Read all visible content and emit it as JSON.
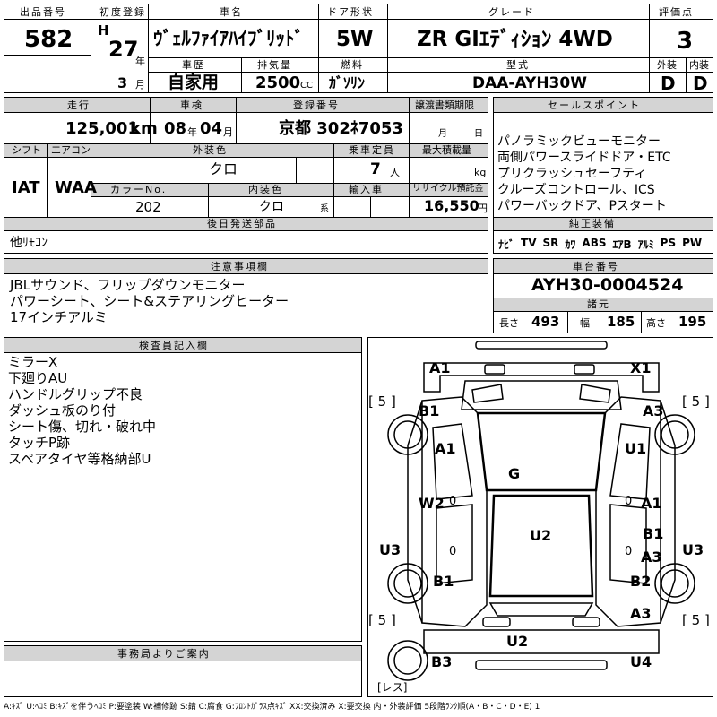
{
  "header": {
    "lot_no_label": "出品番号",
    "lot_no": "582",
    "first_reg_label": "初度登録",
    "era": "H",
    "year": "27",
    "year_unit": "年",
    "month": "3",
    "month_unit": "月",
    "model_label": "車名",
    "model": "ｳﾞｪﾙﾌｧｲｱﾊｲﾌﾞﾘｯﾄﾞ",
    "history_label": "車歴",
    "history": "自家用",
    "displacement_label": "排気量",
    "displacement": "2500",
    "displacement_unit": "CC",
    "door_label": "ドア形状",
    "door": "5W",
    "fuel_label": "燃料",
    "fuel": "ｶﾞｿﾘﾝ",
    "grade_label": "グレード",
    "grade": "ZR GIｴﾃﾞｨｼｮﾝ 4WD",
    "model_code_label": "型式",
    "model_code": "DAA-AYH30W",
    "score_label": "評価点",
    "score": "3",
    "ext_label": "外装",
    "ext": "D",
    "int_label": "内装",
    "int": "D"
  },
  "spec": {
    "mileage_label": "走行",
    "mileage": "125,001",
    "mileage_unit": "km",
    "inspection_label": "車検",
    "insp_year": "08",
    "insp_year_unit": "年",
    "insp_month": "04",
    "insp_month_unit": "月",
    "plate_label": "登録番号",
    "plate": "京都 302ﾈ7053",
    "transfer_label": "譲渡書類期限",
    "transfer_month_unit": "月",
    "transfer_day_unit": "日",
    "shift_label": "シフト",
    "shift": "IAT",
    "ac_label": "エアコン",
    "ac": "WAA",
    "ext_color_label": "外装色",
    "ext_color": "クロ",
    "capacity_label": "乗車定員",
    "capacity": "7",
    "capacity_unit": "人",
    "load_label": "最大積載量",
    "load_unit": "kg",
    "color_no_label": "カラーNo.",
    "color_no": "202",
    "int_color_label": "内装色",
    "int_color": "クロ",
    "int_color_unit": "系",
    "import_label": "輸入車",
    "recycle_label": "リサイクル預託金",
    "recycle": "16,550",
    "recycle_unit": "円"
  },
  "sales": {
    "label": "セールスポイント",
    "items": [
      "パノラミックビューモニター",
      "両側パワースライドドア・ETC",
      "プリクラッシュセーフティ",
      "クルーズコントロール、ICS",
      "パワーバックドア、Pスタート"
    ]
  },
  "later_parts": {
    "label": "後日発送部品",
    "value": "他ﾘﾓｺﾝ"
  },
  "equipment": {
    "label": "純正装備",
    "items": [
      "ﾅﾋﾞ",
      "TV",
      "SR",
      "ｶﾜ",
      "ABS",
      "ｴｱB",
      "ｱﾙﾐ",
      "PS",
      "PW"
    ]
  },
  "notes": {
    "label": "注意事項欄",
    "lines": [
      "JBLサウンド、フリップダウンモニター",
      "パワーシート、シート&ステアリングヒーター",
      "17インチアルミ"
    ]
  },
  "chassis": {
    "label": "車台番号",
    "value": "AYH30-0004524",
    "dims_label": "諸元",
    "length_label": "長さ",
    "length": "493",
    "width_label": "幅",
    "width": "185",
    "height_label": "高さ",
    "height": "195"
  },
  "inspector": {
    "label": "検査員記入欄",
    "lines": [
      "ミラーX",
      "下廻りAU",
      "ハンドルグリップ不良",
      "ダッシュ板のり付",
      "シート傷、切れ・破れ中",
      "タッチP跡",
      "スペアタイヤ等格納部U"
    ]
  },
  "office": {
    "label": "事務局よりご案内"
  },
  "diagram": {
    "marks": [
      "A1",
      "X1",
      "B1",
      "A3",
      "A1",
      "U1",
      "G",
      "W2",
      "A1",
      "U2",
      "B1",
      "A3",
      "U3",
      "U3",
      "B1",
      "B2",
      "A3",
      "U2",
      "B3",
      "U4"
    ],
    "tire_depths": [
      "5",
      "5",
      "5",
      "5"
    ],
    "spare_label": "レス",
    "zero_marks": [
      "0",
      "0",
      "0",
      "0"
    ]
  },
  "legend": "A:ｷｽﾞ U:ﾍｺﾐ B:ｷｽﾞを伴うﾍｺﾐ P:要塗装 W:補修跡 S:錆 C:腐食 G:ﾌﾛﾝﾄｶﾞﾗｽ点ｷｽﾞ XX:交換済み X:要交換 内・外装評価 5段階ﾗﾝｸ順(A・B・C・D・E) 1"
}
